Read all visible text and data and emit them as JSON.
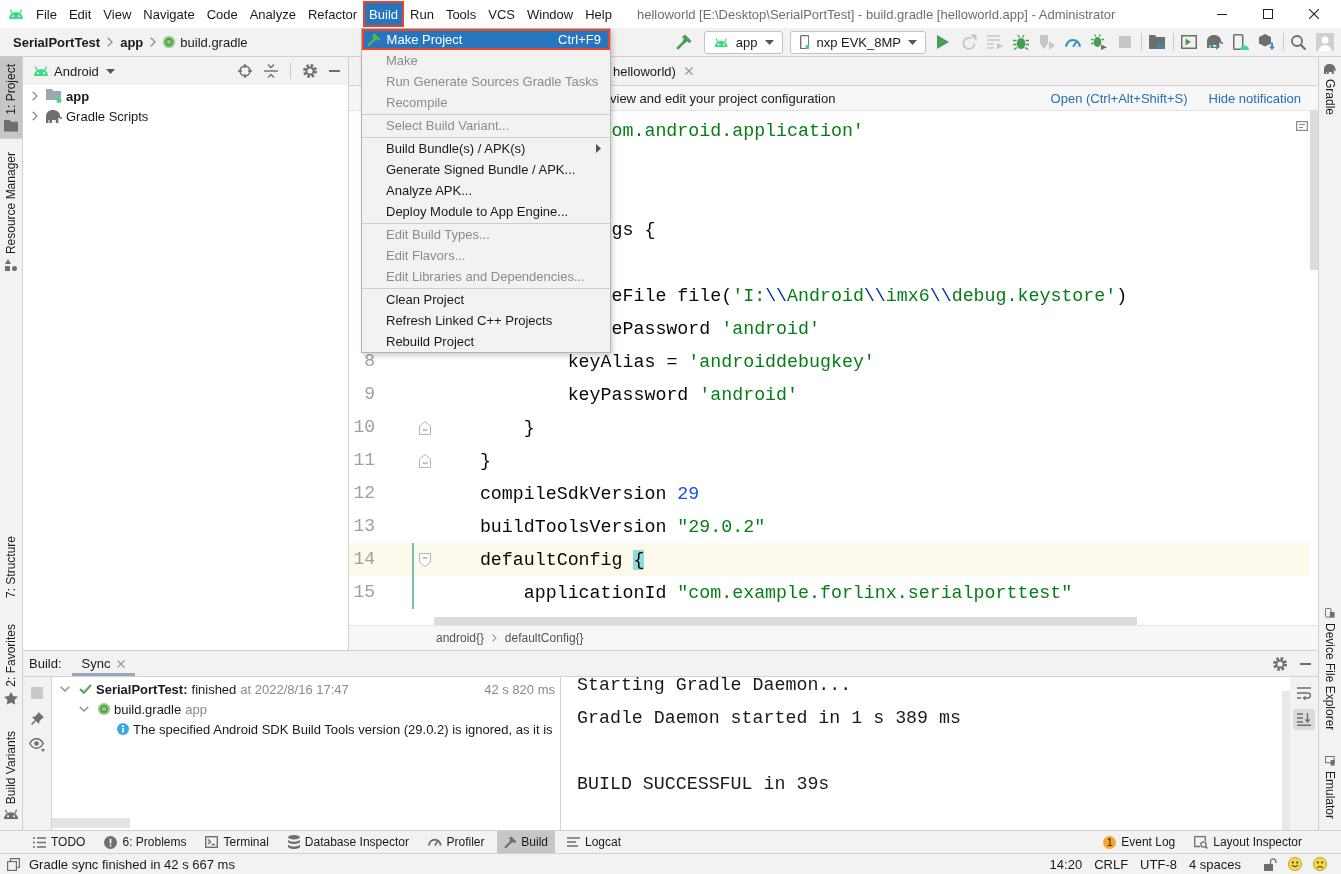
{
  "window": {
    "title": "helloworld [E:\\Desktop\\SerialPortTest] - build.gradle [helloworld.app] - Administrator"
  },
  "menu_bar": [
    {
      "label": "File",
      "selected": false,
      "highlighted": false
    },
    {
      "label": "Edit",
      "selected": false,
      "highlighted": false
    },
    {
      "label": "View",
      "selected": false,
      "highlighted": false
    },
    {
      "label": "Navigate",
      "selected": false,
      "highlighted": false
    },
    {
      "label": "Code",
      "selected": false,
      "highlighted": false
    },
    {
      "label": "Analyze",
      "selected": false,
      "highlighted": false
    },
    {
      "label": "Refactor",
      "selected": false,
      "highlighted": false
    },
    {
      "label": "Build",
      "selected": true,
      "highlighted": true
    },
    {
      "label": "Run",
      "selected": false,
      "highlighted": false
    },
    {
      "label": "Tools",
      "selected": false,
      "highlighted": false
    },
    {
      "label": "VCS",
      "selected": false,
      "highlighted": false
    },
    {
      "label": "Window",
      "selected": false,
      "highlighted": false
    },
    {
      "label": "Help",
      "selected": false,
      "highlighted": false
    }
  ],
  "build_menu": [
    {
      "kind": "action",
      "label": "Make Project",
      "shortcut": "Ctrl+F9",
      "disabled": false,
      "selected": true,
      "highlighted": true,
      "submenu": false
    },
    {
      "kind": "item",
      "label": "Make",
      "disabled": true,
      "selected": false,
      "highlighted": false,
      "submenu": false
    },
    {
      "kind": "item",
      "label": "Run Generate Sources Gradle Tasks",
      "disabled": true,
      "selected": false,
      "highlighted": false,
      "submenu": false
    },
    {
      "kind": "item",
      "label": "Recompile",
      "disabled": true,
      "selected": false,
      "highlighted": false,
      "submenu": false
    },
    {
      "kind": "separator"
    },
    {
      "kind": "item",
      "label": "Select Build Variant...",
      "disabled": true,
      "selected": false,
      "highlighted": false,
      "submenu": false
    },
    {
      "kind": "separator"
    },
    {
      "kind": "item",
      "label": "Build Bundle(s) / APK(s)",
      "disabled": false,
      "selected": false,
      "highlighted": false,
      "submenu": true
    },
    {
      "kind": "item",
      "label": "Generate Signed Bundle / APK...",
      "disabled": false,
      "selected": false,
      "highlighted": false,
      "submenu": false
    },
    {
      "kind": "item",
      "label": "Analyze APK...",
      "disabled": false,
      "selected": false,
      "highlighted": false,
      "submenu": false
    },
    {
      "kind": "item",
      "label": "Deploy Module to App Engine...",
      "disabled": false,
      "selected": false,
      "highlighted": false,
      "submenu": false
    },
    {
      "kind": "separator"
    },
    {
      "kind": "item",
      "label": "Edit Build Types...",
      "disabled": true,
      "selected": false,
      "highlighted": false,
      "submenu": false
    },
    {
      "kind": "item",
      "label": "Edit Flavors...",
      "disabled": true,
      "selected": false,
      "highlighted": false,
      "submenu": false
    },
    {
      "kind": "item",
      "label": "Edit Libraries and Dependencies...",
      "disabled": true,
      "selected": false,
      "highlighted": false,
      "submenu": false
    },
    {
      "kind": "separator"
    },
    {
      "kind": "item",
      "label": "Clean Project",
      "disabled": false,
      "selected": false,
      "highlighted": false,
      "submenu": false
    },
    {
      "kind": "item",
      "label": "Refresh Linked C++ Projects",
      "disabled": false,
      "selected": false,
      "highlighted": false,
      "submenu": false
    },
    {
      "kind": "item",
      "label": "Rebuild Project",
      "disabled": false,
      "selected": false,
      "highlighted": false,
      "submenu": false
    }
  ],
  "navigation_bar": {
    "breadcrumbs": [
      {
        "kind": "project",
        "label": "SerialPortTest"
      },
      {
        "kind": "module",
        "label": "app"
      },
      {
        "kind": "file",
        "label": "build.gradle"
      }
    ],
    "toolbar_start": [
      {
        "kind": "make",
        "disabled": false
      }
    ],
    "run_configuration": "app",
    "device": "nxp EVK_8MP",
    "toolbar_groups": [
      [
        {
          "kind": "run",
          "disabled": false
        },
        {
          "kind": "applychanges",
          "disabled": true
        },
        {
          "kind": "applycode",
          "disabled": true
        },
        {
          "kind": "debug",
          "disabled": false
        },
        {
          "kind": "attach",
          "disabled": true
        },
        {
          "kind": "profile",
          "disabled": false
        },
        {
          "kind": "attachdebug",
          "disabled": false
        },
        {
          "kind": "stop",
          "disabled": true
        }
      ],
      [
        {
          "kind": "structure",
          "disabled": false
        }
      ],
      [
        {
          "kind": "avd",
          "disabled": false
        },
        {
          "kind": "sync",
          "disabled": false
        },
        {
          "kind": "devices",
          "disabled": false
        },
        {
          "kind": "sdk",
          "disabled": false
        }
      ]
    ]
  },
  "left_tool_tabs": {
    "top": [
      {
        "kind": "project",
        "label": "1: Project",
        "selected": true
      },
      {
        "kind": "resources",
        "label": "Resource Manager",
        "selected": false
      }
    ],
    "bottom": [
      {
        "kind": "structure",
        "label": "7: Structure",
        "selected": false
      },
      {
        "kind": "favorites",
        "label": "2: Favorites",
        "selected": false
      },
      {
        "kind": "variants",
        "label": "Build Variants",
        "selected": false
      }
    ]
  },
  "project_panel": {
    "view": "Android",
    "tree": [
      {
        "kind": "module",
        "label": "app",
        "expanded": false
      },
      {
        "kind": "scripts",
        "label": "Gradle Scripts",
        "expanded": false
      }
    ]
  },
  "editor": {
    "tabs": [
      {
        "label": "helloworld)"
      }
    ],
    "notification": {
      "text": "view and edit your project configuration",
      "actions": [
        "Open (Ctrl+Alt+Shift+S)",
        "Hide notification"
      ]
    },
    "lines": [
      {
        "kind": "code",
        "current": false,
        "changed": false,
        "tokens": [
          {
            "kind": "string",
            "text": "                om.android.application'"
          }
        ]
      },
      {
        "kind": "code",
        "current": false,
        "changed": false
      },
      {
        "kind": "code",
        "current": false,
        "changed": false
      },
      {
        "kind": "code",
        "current": false,
        "changed": false,
        "tokens": [
          {
            "kind": "plain",
            "text": "                gs {"
          }
        ]
      },
      {
        "kind": "code",
        "current": false,
        "changed": false
      },
      {
        "kind": "code",
        "current": false,
        "changed": false,
        "tokens": [
          {
            "kind": "plain",
            "text": "                eFile file("
          },
          {
            "kind": "string",
            "text": "'I:"
          },
          {
            "kind": "escape",
            "text": "\\\\"
          },
          {
            "kind": "string",
            "text": "Android"
          },
          {
            "kind": "escape",
            "text": "\\\\"
          },
          {
            "kind": "string",
            "text": "imx6"
          },
          {
            "kind": "escape",
            "text": "\\\\"
          },
          {
            "kind": "string",
            "text": "debug.keystore'"
          },
          {
            "kind": "plain",
            "text": ")"
          }
        ]
      },
      {
        "kind": "code",
        "current": false,
        "changed": false,
        "tokens": [
          {
            "kind": "plain",
            "text": "                ePassword "
          },
          {
            "kind": "string",
            "text": "'android'"
          }
        ]
      },
      {
        "kind": "code",
        "number": "8",
        "current": false,
        "changed": false,
        "tokens": [
          {
            "kind": "plain",
            "text": "            keyAlias = "
          },
          {
            "kind": "string",
            "text": "'androiddebugkey'"
          }
        ]
      },
      {
        "kind": "code",
        "number": "9",
        "current": false,
        "changed": false,
        "tokens": [
          {
            "kind": "plain",
            "text": "            keyPassword "
          },
          {
            "kind": "string",
            "text": "'android'"
          }
        ]
      },
      {
        "kind": "foldend",
        "number": "10",
        "current": false,
        "changed": false,
        "tokens": [
          {
            "kind": "plain",
            "text": "        }"
          }
        ]
      },
      {
        "kind": "foldend",
        "number": "11",
        "current": false,
        "changed": false,
        "tokens": [
          {
            "kind": "plain",
            "text": "    }"
          }
        ]
      },
      {
        "kind": "code",
        "number": "12",
        "current": false,
        "changed": false,
        "tokens": [
          {
            "kind": "plain",
            "text": "    compileSdkVersion "
          },
          {
            "kind": "number",
            "text": "29"
          }
        ]
      },
      {
        "kind": "code",
        "number": "13",
        "current": false,
        "changed": false,
        "tokens": [
          {
            "kind": "plain",
            "text": "    buildToolsVersion "
          },
          {
            "kind": "string",
            "text": "\"29.0.2\""
          }
        ]
      },
      {
        "kind": "foldstart",
        "number": "14",
        "current": true,
        "changed": true,
        "tokens": [
          {
            "kind": "plain",
            "text": "    defaultConfig "
          },
          {
            "kind": "brace",
            "text": "{"
          }
        ]
      },
      {
        "kind": "code",
        "number": "15",
        "current": false,
        "changed": true,
        "tokens": [
          {
            "kind": "plain",
            "text": "        applicationId "
          },
          {
            "kind": "string",
            "text": "\"com.example.forlinx.serialporttest\""
          }
        ]
      }
    ],
    "breadcrumbs": [
      "android{}",
      "defaultConfig{}"
    ]
  },
  "right_tool_tabs": {
    "top": [
      {
        "kind": "gradle",
        "label": "Gradle",
        "selected": false
      }
    ],
    "bottom": [
      {
        "kind": "files",
        "label": "Device File Explorer",
        "selected": false
      },
      {
        "kind": "emulator",
        "label": "Emulator",
        "selected": false
      }
    ]
  },
  "build_panel": {
    "title": "Build:",
    "tabs": [
      {
        "label": "Sync",
        "selected": true
      }
    ],
    "tree": [
      {
        "kind": "success",
        "name": "SerialPortTest:",
        "status": "finished",
        "time": "at 2022/8/16 17:47",
        "duration": "42 s 820 ms",
        "expanded": true,
        "children": [
          {
            "kind": "file",
            "name": "build.gradle",
            "module": "app",
            "expanded": true,
            "children": [
              {
                "kind": "info",
                "name": "The specified Android SDK Build Tools version (29.0.2) is ignored, as it is"
              }
            ]
          }
        ]
      }
    ],
    "console": [
      [
        "Starting Gradle Daemon...",
        "Gradle Daemon started in 1 s 389 ms"
      ],
      [
        "BUILD SUCCESSFUL in 39s"
      ]
    ],
    "console_toolbar": [
      {
        "kind": "wrap",
        "selected": false
      },
      {
        "kind": "scrollend",
        "selected": true
      }
    ]
  },
  "tool_strip": {
    "left": [
      {
        "kind": "todo",
        "label": "TODO",
        "selected": false
      },
      {
        "kind": "problems",
        "label": "6: Problems",
        "selected": false
      },
      {
        "kind": "terminal",
        "label": "Terminal",
        "selected": false
      },
      {
        "kind": "database",
        "label": "Database Inspector",
        "selected": false
      },
      {
        "kind": "profiler",
        "label": "Profiler",
        "selected": false
      },
      {
        "kind": "build",
        "label": "Build",
        "selected": true
      },
      {
        "kind": "logcat",
        "label": "Logcat",
        "selected": false
      }
    ],
    "right": [
      {
        "kind": "events",
        "label": "Event Log",
        "count": "1",
        "selected": false
      },
      {
        "kind": "inspector",
        "label": "Layout Inspector",
        "selected": false
      }
    ]
  },
  "status_bar": {
    "message": "Gradle sync finished in 42 s 667 ms",
    "fields": [
      "14:20",
      "CRLF",
      "UTF-8",
      "4 spaces"
    ]
  }
}
